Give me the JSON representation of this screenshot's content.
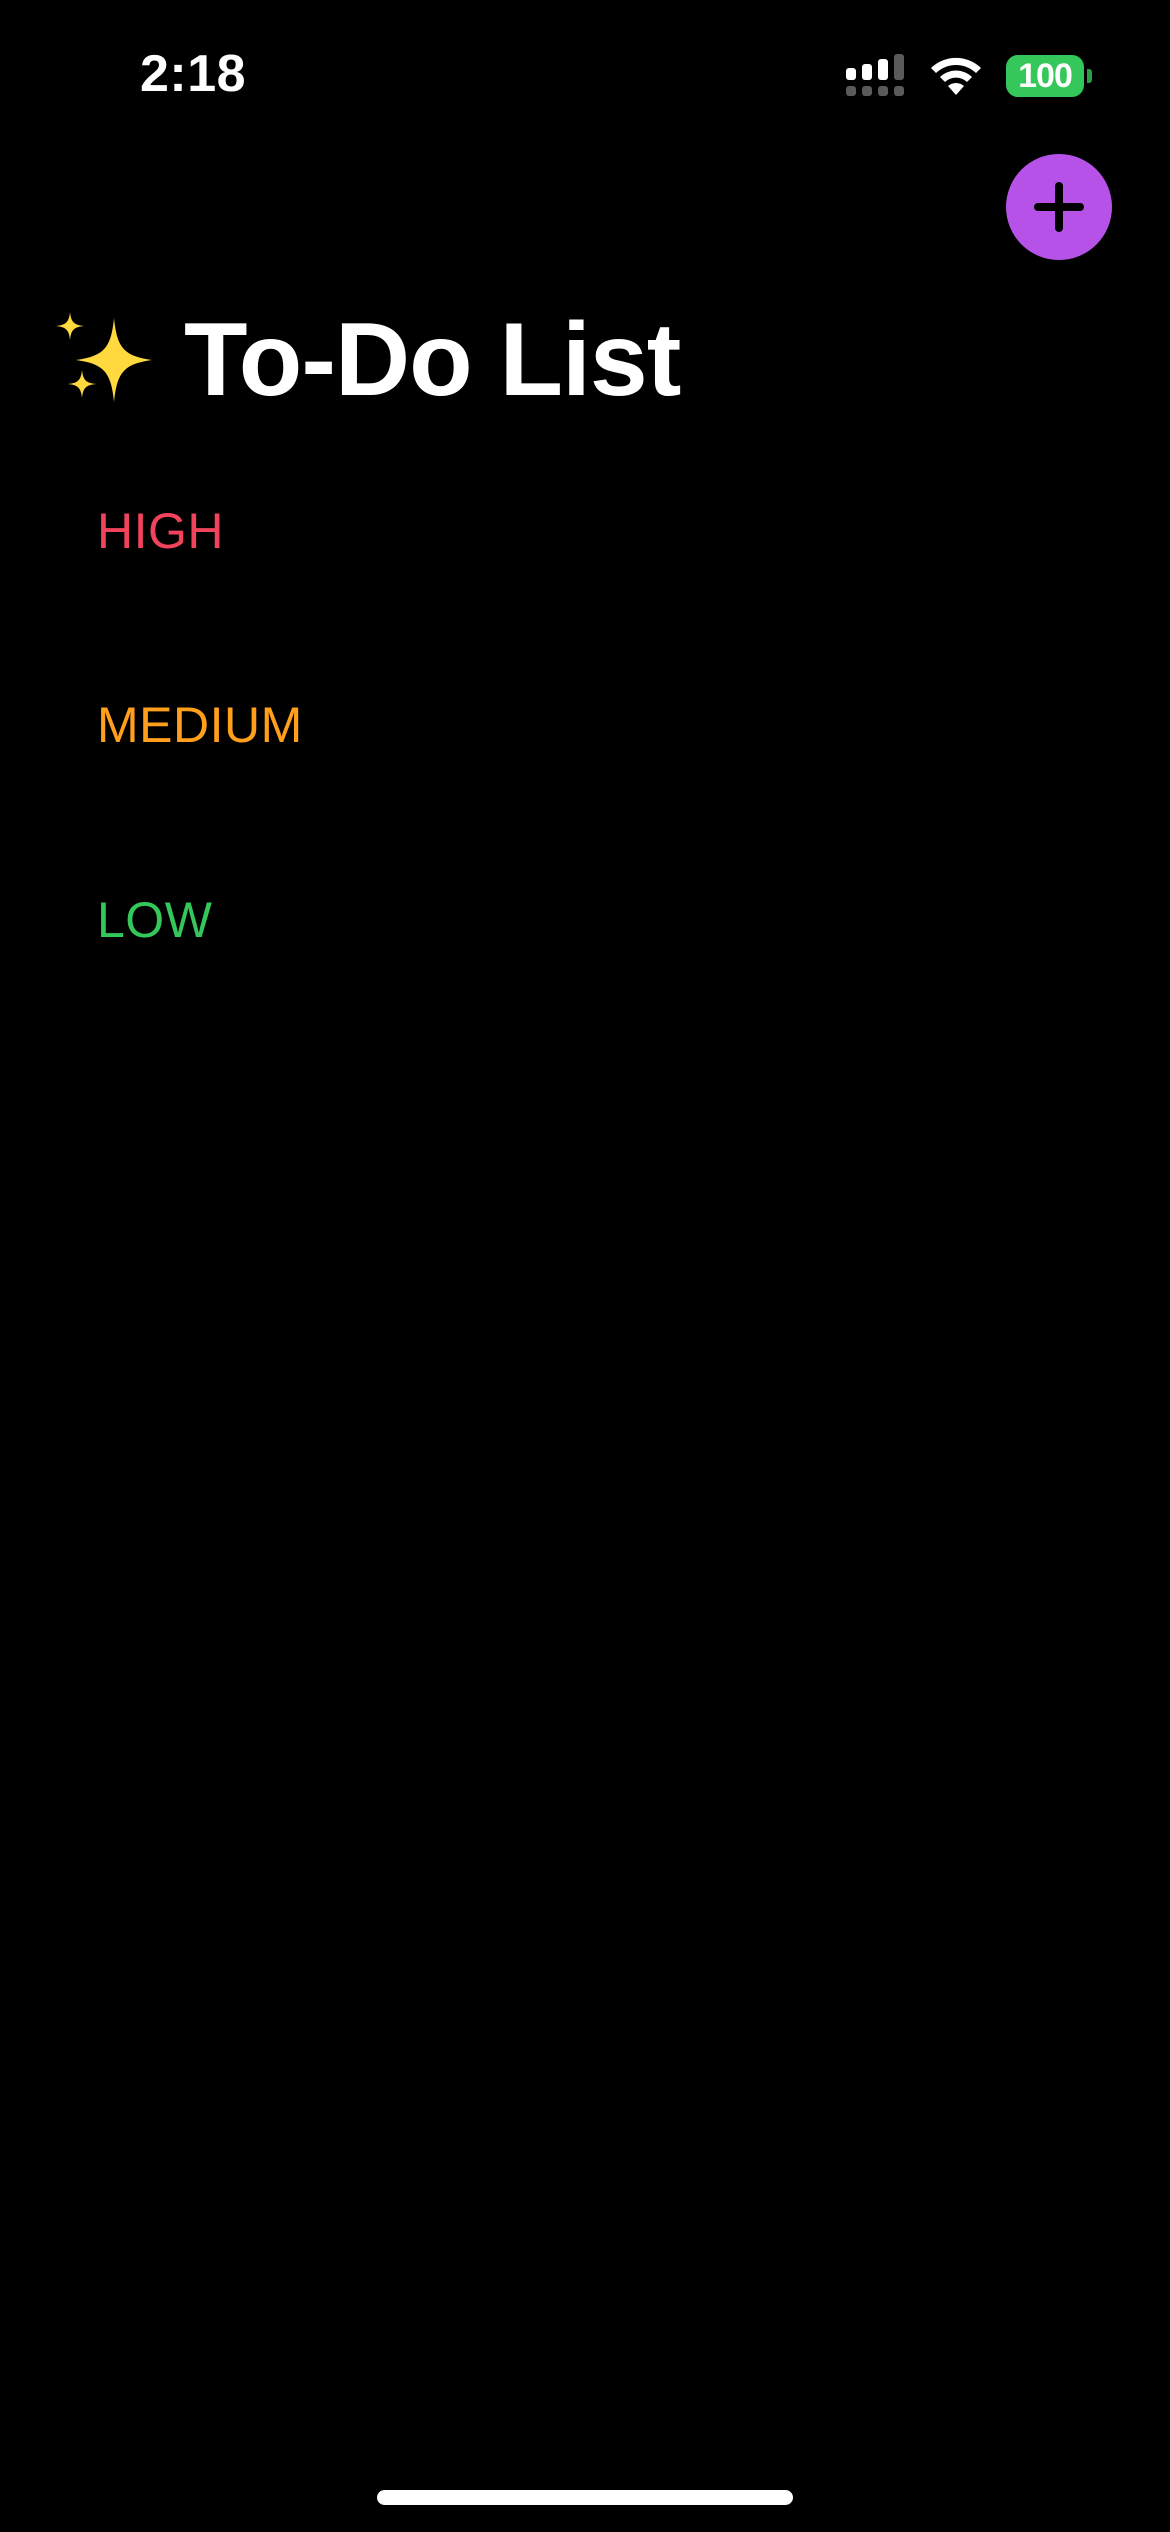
{
  "status_bar": {
    "time": "2:18",
    "battery_level": "100",
    "signal_icon": "cellular-signal-icon",
    "wifi_icon": "wifi-icon",
    "battery_color": "#34c759"
  },
  "header": {
    "title": "To-Do List",
    "title_icon": "sparkles-icon",
    "add_button_icon": "plus-icon",
    "add_button_color": "#b652e8"
  },
  "sections": [
    {
      "label": "HIGH",
      "color": "#f2435d"
    },
    {
      "label": "MEDIUM",
      "color": "#ff9f1c"
    },
    {
      "label": "LOW",
      "color": "#34c759"
    }
  ]
}
